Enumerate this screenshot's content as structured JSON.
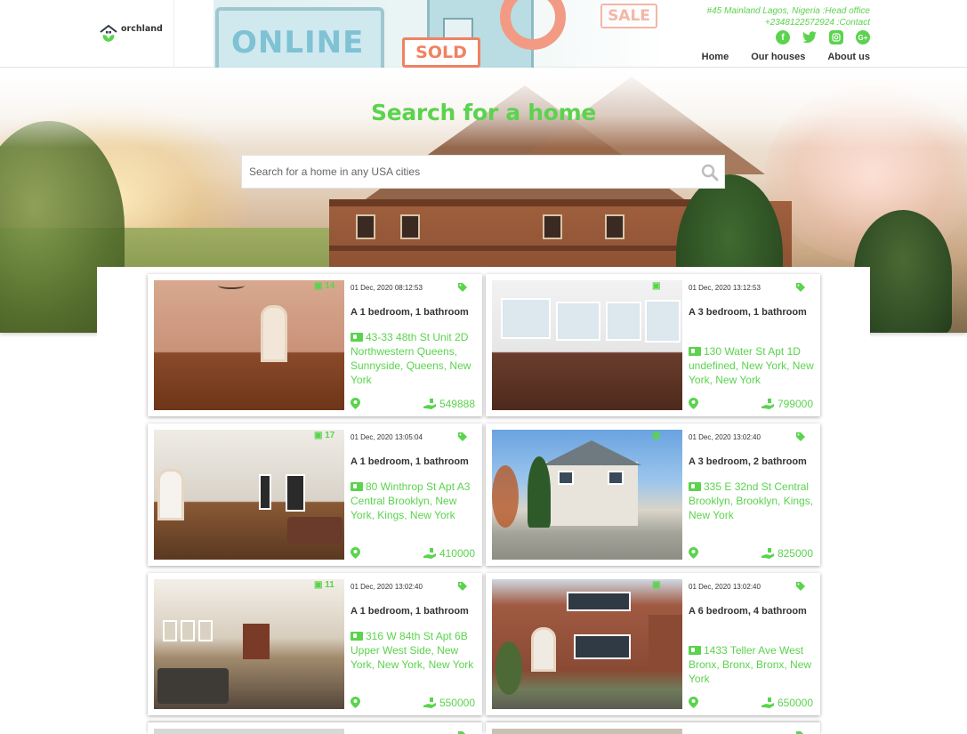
{
  "brand": {
    "name": "orchland",
    "accent": "#5bd34e"
  },
  "banner": {
    "online": "ONLINE",
    "sold": "SOLD",
    "sale": "SALE"
  },
  "contact": {
    "office": "#45 Mainland Lagos, Nigeria :Head office",
    "phone": "+2348122572924 :Contact"
  },
  "socials": [
    {
      "name": "facebook-icon",
      "glyph": "f"
    },
    {
      "name": "twitter-icon",
      "glyph": "🐦"
    },
    {
      "name": "instagram-icon",
      "glyph": "◎"
    },
    {
      "name": "google-plus-icon",
      "glyph": "G+"
    }
  ],
  "nav": {
    "home": "Home",
    "houses": "Our houses",
    "about": "About us"
  },
  "hero": {
    "title": "Search for a home",
    "search_placeholder": "Search for a home in any USA cities"
  },
  "listings": [
    {
      "date": "01 Dec, 2020 08:12:53",
      "rooms": "A 1 bedroom, 1 bathroom",
      "address": "43-33 48th St Unit 2D Northwestern Queens, Sunnyside, Queens, New York",
      "price": "549888",
      "photos": "14"
    },
    {
      "date": "01 Dec, 2020 13:12:53",
      "rooms": "A 3 bedroom, 1 bathroom",
      "address": "130 Water St Apt 1D undefined, New York, New York, New York",
      "price": "799000",
      "photos": ""
    },
    {
      "date": "01 Dec, 2020 13:05:04",
      "rooms": "A 1 bedroom, 1 bathroom",
      "address": "80 Winthrop St Apt A3 Central Brooklyn, New York, Kings, New York",
      "price": "410000",
      "photos": "17"
    },
    {
      "date": "01 Dec, 2020 13:02:40",
      "rooms": "A 3 bedroom, 2 bathroom",
      "address": "335 E 32nd St Central Brooklyn, Brooklyn, Kings, New York",
      "price": "825000",
      "photos": ""
    },
    {
      "date": "01 Dec, 2020 13:02:40",
      "rooms": "A 1 bedroom, 1 bathroom",
      "address": "316 W 84th St Apt 6B Upper West Side, New York, New York, New York",
      "price": "550000",
      "photos": "11"
    },
    {
      "date": "01 Dec, 2020 13:02:40",
      "rooms": "A 6 bedroom, 4 bathroom",
      "address": "1433 Teller Ave West Bronx, Bronx, Bronx, New York",
      "price": "650000",
      "photos": ""
    }
  ]
}
